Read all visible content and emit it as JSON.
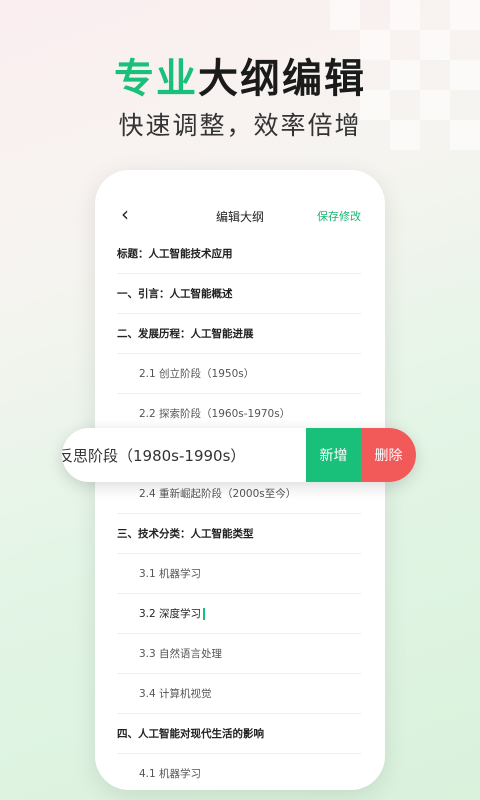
{
  "headline": {
    "accent": "专业",
    "rest": "大纲编辑"
  },
  "subline": "快速调整，效率倍增",
  "nav": {
    "back_icon": "‹",
    "title": "编辑大纲",
    "save": "保存修改"
  },
  "outline": [
    {
      "text": "标题：人工智能技术应用",
      "level": 1
    },
    {
      "text": "一、引言：人工智能概述",
      "level": 1
    },
    {
      "text": "二、发展历程：人工智能进展",
      "level": 1
    },
    {
      "text": "2.1 创立阶段（1950s）",
      "level": 2
    },
    {
      "text": "2.2 探索阶段（1960s-1970s）",
      "level": 2
    },
    {
      "text": "",
      "level": 2
    },
    {
      "text": "2.4 重新崛起阶段（2000s至今）",
      "level": 2
    },
    {
      "text": "三、技术分类：人工智能类型",
      "level": 1
    },
    {
      "text": "3.1 机器学习",
      "level": 2
    },
    {
      "text": "3.2 深度学习",
      "level": 2
    },
    {
      "text": "3.3 自然语言处理",
      "level": 2
    },
    {
      "text": "3.4 计算机视觉",
      "level": 2
    },
    {
      "text": "四、人工智能对现代生活的影响",
      "level": 1
    },
    {
      "text": "4.1 机器学习",
      "level": 2
    }
  ],
  "swipe": {
    "text": "反思阶段（1980s-1990s）",
    "add": "新增",
    "delete": "删除"
  }
}
